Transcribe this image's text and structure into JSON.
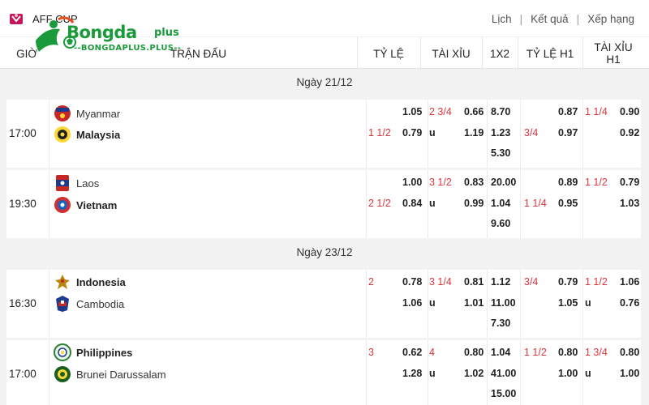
{
  "league": {
    "name": "AFF CUP"
  },
  "nav": {
    "schedule": "Lịch",
    "results": "Kết quả",
    "standings": "Xếp hạng",
    "sep": "|"
  },
  "brand": {
    "word": "Bongda",
    "plus": "plus",
    "sub": "--BONGDAPLUS.PLUS--"
  },
  "header": {
    "time": "GIỜ",
    "match": "TRẬN ĐẤU",
    "handicap": "TỶ LỆ",
    "overunder": "TÀI XỈU",
    "x12": "1X2",
    "handicap_h1": "TỶ LỆ H1",
    "overunder_h1_l1": "TÀI XỈU",
    "overunder_h1_l2": "H1"
  },
  "colors": {
    "accent_red": "#d9373b",
    "brand_green": "#1a9a3a"
  },
  "days": [
    {
      "label": "Ngày 21/12",
      "matches": [
        {
          "time": "17:00",
          "home": {
            "name": "Myanmar",
            "flag": "myanmar-flag-icon",
            "bold": false
          },
          "away": {
            "name": "Malaysia",
            "flag": "malaysia-flag-icon",
            "bold": true
          },
          "hdp_line": "1 1/2",
          "hdp_home": "1.05",
          "hdp_away": "0.79",
          "ou_line": "2 3/4",
          "ou_over": "0.66",
          "ou_u": "u",
          "ou_under": "1.19",
          "x1": "8.70",
          "x2": "1.23",
          "xd": "5.30",
          "h1_line": "3/4",
          "h1_home": "0.87",
          "h1_away": "0.97",
          "h1ou_line": "1 1/4",
          "h1ou_over": "0.90",
          "h1ou_u": "",
          "h1ou_under": "0.92"
        },
        {
          "time": "19:30",
          "home": {
            "name": "Laos",
            "flag": "laos-flag-icon",
            "bold": false
          },
          "away": {
            "name": "Vietnam",
            "flag": "vietnam-flag-icon",
            "bold": true
          },
          "hdp_line": "2 1/2",
          "hdp_home": "1.00",
          "hdp_away": "0.84",
          "ou_line": "3 1/2",
          "ou_over": "0.83",
          "ou_u": "u",
          "ou_under": "0.99",
          "x1": "20.00",
          "x2": "1.04",
          "xd": "9.60",
          "h1_line": "1 1/4",
          "h1_home": "0.89",
          "h1_away": "0.95",
          "h1ou_line": "1 1/2",
          "h1ou_over": "0.79",
          "h1ou_u": "",
          "h1ou_under": "1.03"
        }
      ]
    },
    {
      "label": "Ngày 23/12",
      "matches": [
        {
          "time": "16:30",
          "home": {
            "name": "Indonesia",
            "flag": "indonesia-flag-icon",
            "bold": true
          },
          "away": {
            "name": "Cambodia",
            "flag": "cambodia-flag-icon",
            "bold": false
          },
          "hdp_line": "2",
          "hdp_home": "0.78",
          "hdp_away": "1.06",
          "ou_line": "3 1/4",
          "ou_over": "0.81",
          "ou_u": "u",
          "ou_under": "1.01",
          "x1": "1.12",
          "x2": "11.00",
          "xd": "7.30",
          "h1_line": "3/4",
          "h1_home": "0.79",
          "h1_away": "1.05",
          "h1ou_line": "1 1/2",
          "h1ou_over": "1.06",
          "h1ou_u": "u",
          "h1ou_under": "0.76"
        },
        {
          "time": "17:00",
          "home": {
            "name": "Philippines",
            "flag": "philippines-flag-icon",
            "bold": true
          },
          "away": {
            "name": "Brunei Darussalam",
            "flag": "brunei-flag-icon",
            "bold": false
          },
          "hdp_line": "3",
          "hdp_home": "0.62",
          "hdp_away": "1.28",
          "ou_line": "4",
          "ou_over": "0.80",
          "ou_u": "u",
          "ou_under": "1.02",
          "x1": "1.04",
          "x2": "41.00",
          "xd": "15.00",
          "h1_line": "1 1/2",
          "h1_home": "0.80",
          "h1_away": "1.00",
          "h1ou_line": "1 3/4",
          "h1ou_over": "0.80",
          "h1ou_u": "u",
          "h1ou_under": "1.00"
        }
      ]
    }
  ]
}
